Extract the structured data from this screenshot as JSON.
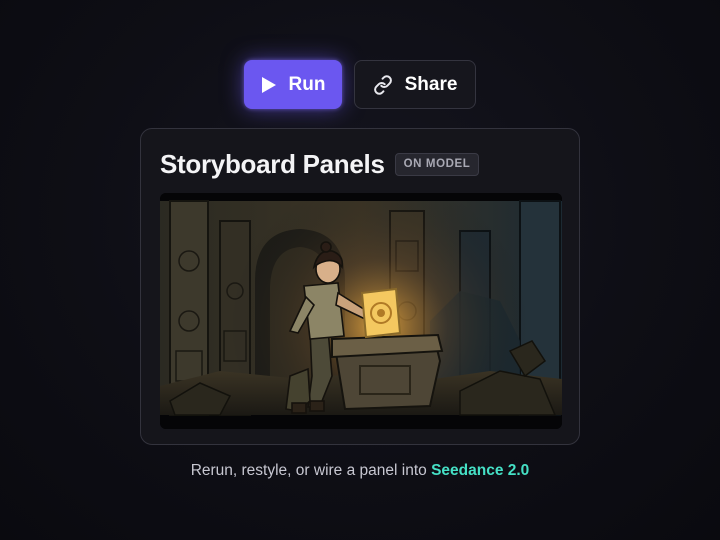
{
  "actions": {
    "run_label": "Run",
    "share_label": "Share",
    "run_icon": "play-icon",
    "share_icon": "link-icon"
  },
  "card": {
    "title": "Storyboard Panels",
    "badge": "ON MODEL",
    "panel_image": "storyboard-panel-illustration"
  },
  "caption": {
    "text": "Rerun, restyle, or wire a panel into ",
    "accent": "Seedance 2.0"
  },
  "colors": {
    "accent_primary": "#6b57f0",
    "accent_secondary": "#45e0c5",
    "background": "#0e0e15"
  }
}
